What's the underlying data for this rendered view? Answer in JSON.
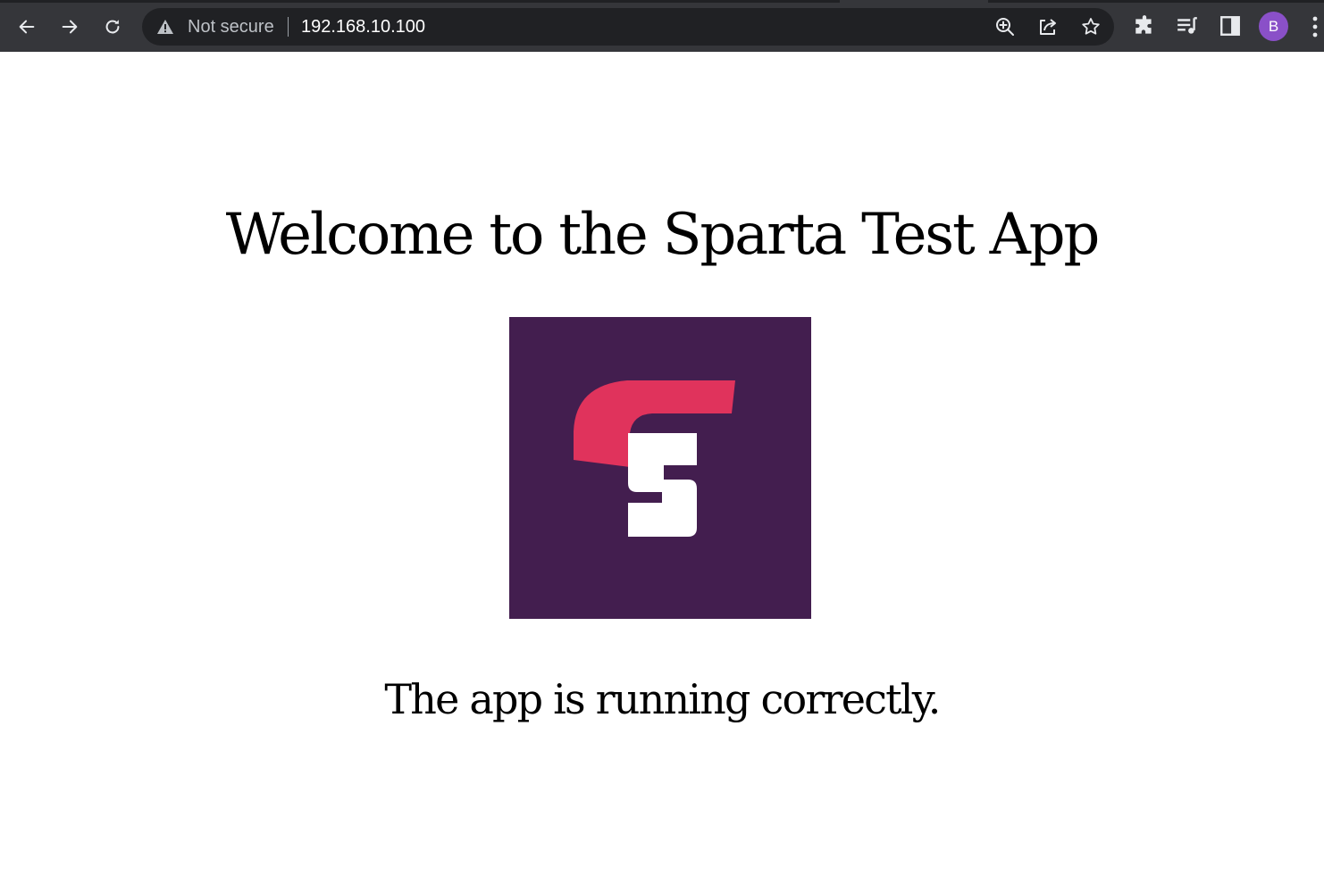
{
  "browser": {
    "security_label": "Not secure",
    "url": "192.168.10.100",
    "profile_initial": "B",
    "icons": {
      "back": "back-arrow-icon",
      "forward": "forward-arrow-icon",
      "reload": "reload-icon",
      "warning": "warning-triangle-icon",
      "zoom": "zoom-icon",
      "share": "share-icon",
      "bookmark": "star-icon",
      "extensions": "puzzle-icon",
      "media": "media-queue-icon",
      "side_panel": "side-panel-icon",
      "menu": "kebab-menu-icon"
    }
  },
  "page": {
    "heading": "Welcome to the Sparta Test App",
    "status": "The app is running correctly.",
    "colors": {
      "logo_background": "#431e4f",
      "logo_accent": "#e0335c",
      "logo_letter": "#ffffff"
    }
  }
}
